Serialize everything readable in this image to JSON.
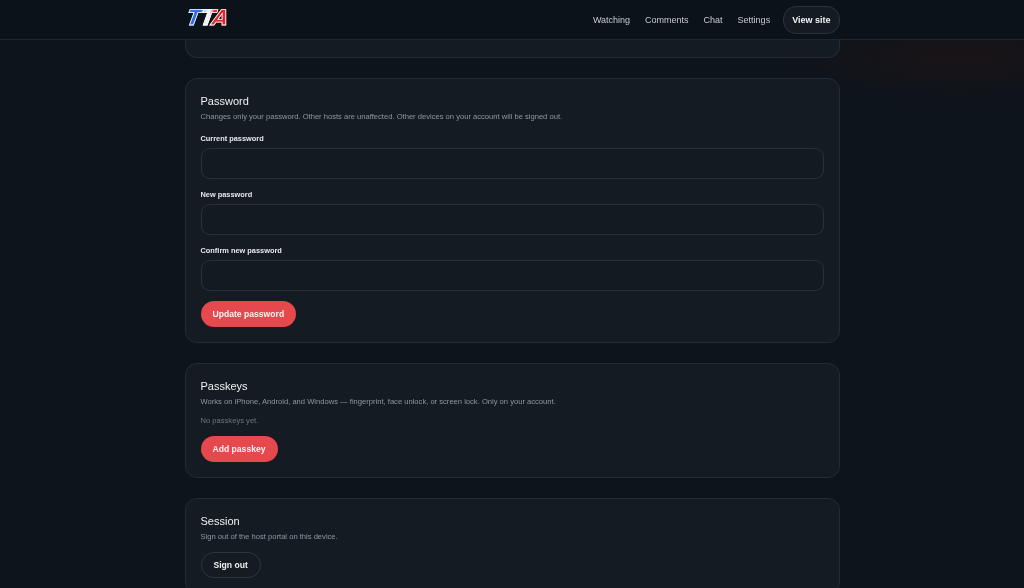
{
  "header": {
    "logo": "TTA",
    "nav": [
      {
        "label": "Watching",
        "kind": "link"
      },
      {
        "label": "Comments",
        "kind": "link"
      },
      {
        "label": "Chat",
        "kind": "link"
      },
      {
        "label": "Settings",
        "kind": "link"
      },
      {
        "label": "View site",
        "kind": "button"
      }
    ]
  },
  "sections": [
    {
      "title": "Password",
      "description": "Changes only your password. Other hosts are unaffected. Other devices on your account will be signed out.",
      "fields": [
        {
          "label": "Current password"
        },
        {
          "label": "New password"
        },
        {
          "label": "Confirm new password"
        }
      ],
      "actions": [
        {
          "label": "Update password",
          "kind": "primary"
        }
      ]
    },
    {
      "title": "Passkeys",
      "description": "Works on iPhone, Android, and Windows — fingerprint, face unlock, or screen lock. Only on your account.",
      "note": "No passkeys yet.",
      "actions": [
        {
          "label": "Add passkey",
          "kind": "primary"
        }
      ]
    },
    {
      "title": "Session",
      "description": "Sign out of the host portal on this device.",
      "actions": [
        {
          "label": "Sign out",
          "kind": "secondary"
        }
      ]
    }
  ]
}
